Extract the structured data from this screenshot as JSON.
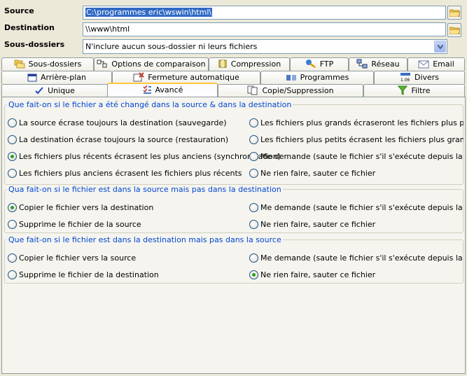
{
  "fields": {
    "source_label": "Source",
    "source_value": "C:\\programmes eric\\wswin\\html\\",
    "destination_label": "Destination",
    "destination_value": "\\\\www\\html",
    "subfolders_label": "Sous-dossiers",
    "subfolders_value": "N'inclure aucun sous-dossier ni leurs fichiers"
  },
  "tabs": {
    "row1": [
      {
        "label": "Sous-dossiers",
        "icon": "subfolders-icon"
      },
      {
        "label": "Options de comparaison",
        "icon": "compare-icon"
      },
      {
        "label": "Compression",
        "icon": "compression-icon"
      },
      {
        "label": "FTP",
        "icon": "ftp-icon"
      },
      {
        "label": "Réseau",
        "icon": "network-icon"
      },
      {
        "label": "Email",
        "icon": "email-icon"
      }
    ],
    "row2": [
      {
        "label": "Arrière-plan",
        "icon": "window-icon"
      },
      {
        "label": "Fermeture automatique",
        "icon": "autoclose-icon"
      },
      {
        "label": "Programmes",
        "icon": "programs-icon"
      },
      {
        "label": "Divers",
        "icon": "misc-icon"
      }
    ],
    "row3": [
      {
        "label": "Unique",
        "icon": "checkmark-icon"
      },
      {
        "label": "Avancé",
        "icon": "advanced-icon"
      },
      {
        "label": "Copie/Suppression",
        "icon": "copy-icon"
      },
      {
        "label": "Filtre",
        "icon": "filter-icon"
      }
    ],
    "active": "Avancé"
  },
  "groups": [
    {
      "title": "Que fait-on si le fichier a été changé dans la source & dans la destination",
      "left_options": [
        {
          "label": "La source écrase toujours la destination (sauvegarde)",
          "checked": false
        },
        {
          "label": "La destination écrase toujours la source (restauration)",
          "checked": false
        },
        {
          "label": "Les fichiers plus récents écrasent les plus anciens (synchronisation)",
          "checked": true
        },
        {
          "label": "Les fichiers plus anciens écrasent les fichiers plus récents",
          "checked": false
        }
      ],
      "right_options": [
        {
          "label": "Les fichiers plus grands écraseront les fichiers plus petits (sa",
          "checked": false
        },
        {
          "label": "Les fichiers plus petits écrasent les fichiers plus grands (saut",
          "checked": false
        },
        {
          "label": "Me demande (saute le fichier s'il s'exécute depuis la ligne de",
          "checked": false
        },
        {
          "label": "Ne rien faire, sauter ce fichier",
          "checked": false
        }
      ]
    },
    {
      "title": "Qua fait-on si le fichier est dans la source mais pas dans la destination",
      "left_options": [
        {
          "label": "Copier le fichier vers la destination",
          "checked": true
        },
        {
          "label": "Supprime le fichier de la source",
          "checked": false
        }
      ],
      "right_options": [
        {
          "label": "Me demande (saute le fichier s'il s'exécute depuis la ligne de",
          "checked": false
        },
        {
          "label": "Ne rien faire, sauter ce fichier",
          "checked": false
        }
      ]
    },
    {
      "title": "Que fait-on si le fichier est dans la destination mais pas dans la source",
      "left_options": [
        {
          "label": "Copier le fichier vers la source",
          "checked": false
        },
        {
          "label": "Supprime le fichier de la destination",
          "checked": false
        }
      ],
      "right_options": [
        {
          "label": "Me demande (saute le fichier s'il s'exécute depuis la ligne de",
          "checked": false
        },
        {
          "label": "Ne rien faire, sauter ce fichier",
          "checked": true
        }
      ]
    }
  ]
}
